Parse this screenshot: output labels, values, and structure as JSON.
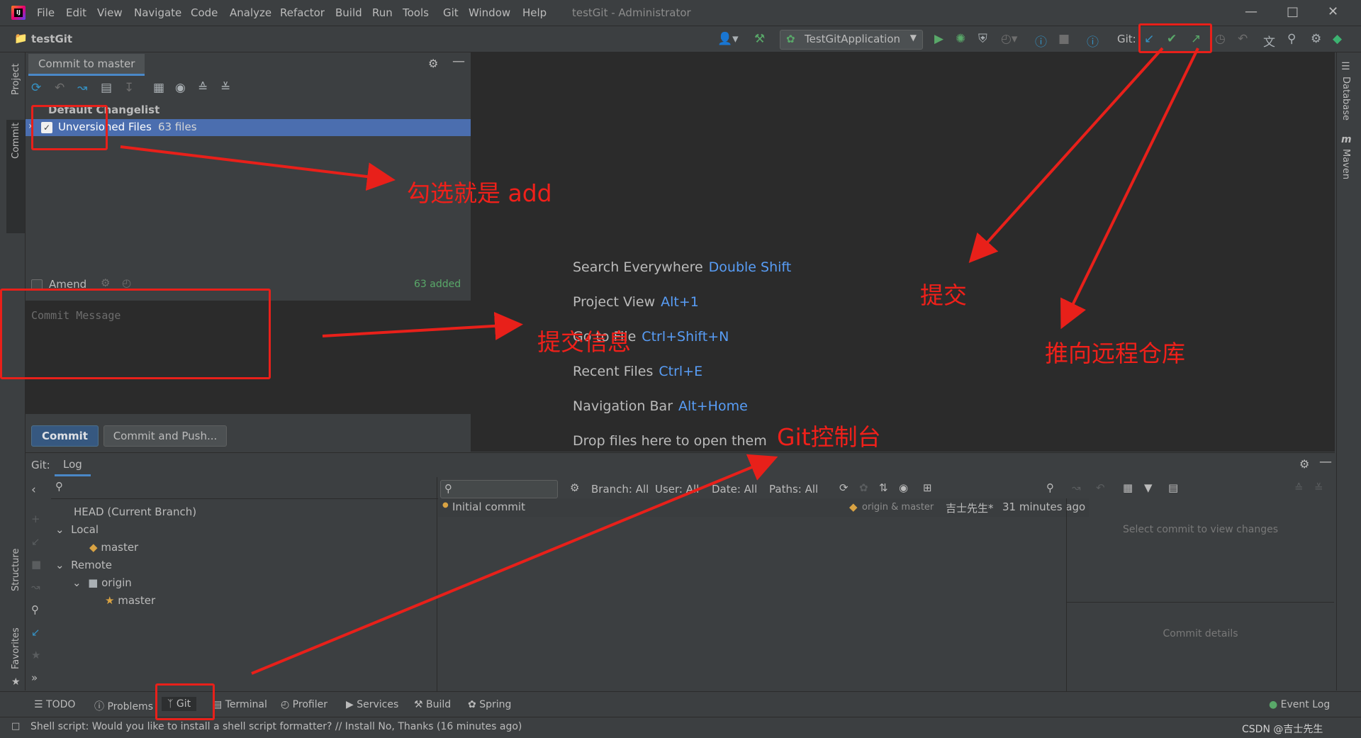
{
  "window": {
    "title": "testGit - Administrator",
    "menu": [
      "File",
      "Edit",
      "View",
      "Navigate",
      "Code",
      "Analyze",
      "Refactor",
      "Build",
      "Run",
      "Tools",
      "Git",
      "Window",
      "Help"
    ]
  },
  "toolbar": {
    "project_name": "testGit",
    "run_config": "TestGitApplication",
    "git_label": "Git:"
  },
  "side_tabs": {
    "left_top": [
      "Project",
      "Commit"
    ],
    "left_bottom": [
      "Structure",
      "Favorites"
    ],
    "right": [
      "Database",
      "Maven"
    ]
  },
  "commit_panel": {
    "tab": "Commit to master",
    "changelist_header": "Default Changelist",
    "changelist_row": "Unversioned Files",
    "changelist_count": "63 files",
    "amend_label": "Amend",
    "added_status": "63 added",
    "message_placeholder": "Commit Message",
    "commit_button": "Commit",
    "commit_push_button": "Commit and Push..."
  },
  "editor_hints": [
    {
      "label": "Search Everywhere",
      "key": "Double Shift"
    },
    {
      "label": "Project View",
      "key": "Alt+1"
    },
    {
      "label": "Go to File",
      "key": "Ctrl+Shift+N"
    },
    {
      "label": "Recent Files",
      "key": "Ctrl+E"
    },
    {
      "label": "Navigation Bar",
      "key": "Alt+Home"
    },
    {
      "label": "Drop files here to open them",
      "key": ""
    }
  ],
  "git_panel": {
    "label": "Git:",
    "tab": "Log",
    "filters": [
      "Branch: All",
      "User: All",
      "Date: All",
      "Paths: All"
    ],
    "tree": {
      "head": "HEAD (Current Branch)",
      "local": "Local",
      "local_branch": "master",
      "remote": "Remote",
      "origin": "origin",
      "remote_branch": "master"
    },
    "commits": [
      {
        "message": "Initial commit",
        "refs": "origin & master",
        "author": "吉士先生*",
        "time": "31 minutes ago"
      }
    ],
    "details_hint": "Select commit to view changes",
    "details_label": "Commit details"
  },
  "bottom_tabs": [
    "TODO",
    "Problems",
    "Git",
    "Terminal",
    "Profiler",
    "Services",
    "Build",
    "Spring"
  ],
  "event_log": "Event Log",
  "status_message": "Shell script: Would you like to install a shell script formatter? // Install   No, Thanks (16 minutes ago)",
  "watermark": "CSDN @吉士先生",
  "annotations": {
    "check_add": "勾选就是 add",
    "commit": "提交",
    "commit_message": "提交信息",
    "push_remote": "推向远程仓库",
    "git_console": "Git控制台"
  },
  "colors": {
    "accent": "#4b6eaf",
    "annotation": "#e8201a",
    "link_key": "#589df6"
  }
}
